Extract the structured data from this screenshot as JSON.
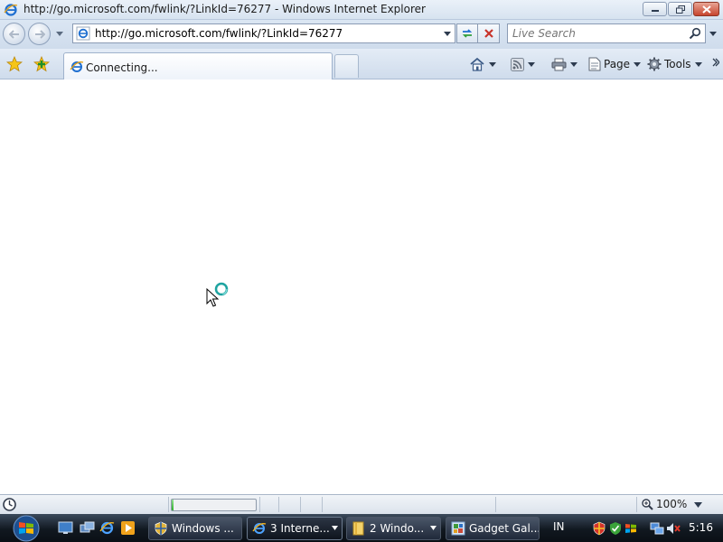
{
  "window": {
    "title": "http://go.microsoft.com/fwlink/?LinkId=76277 - Windows Internet Explorer",
    "buttons": {
      "minimize": "minimize",
      "maximize": "maximize",
      "close": "close"
    }
  },
  "address_bar": {
    "url": "http://go.microsoft.com/fwlink/?LinkId=76277"
  },
  "search": {
    "placeholder": "Live Search"
  },
  "tabs": [
    {
      "label": "Connecting...",
      "active": true
    }
  ],
  "command_bar": {
    "page_label": "Page",
    "tools_label": "Tools"
  },
  "status_bar": {
    "progress_fraction": 0.02,
    "zoom": "100%"
  },
  "taskbar": {
    "tasks": [
      {
        "label": "Windows ...",
        "icon": "shield-icon",
        "active": false
      },
      {
        "label": "3 Interne...",
        "icon": "ie-icon",
        "active": true
      },
      {
        "label": "2 Windo...",
        "icon": "folder-icon",
        "active": false
      },
      {
        "label": "Gadget Gal...",
        "icon": "gadget-icon",
        "active": false
      }
    ],
    "language": "IN",
    "clock": "5:16"
  },
  "colors": {
    "accent": "#2fb12b",
    "taskbar": "#111820",
    "chrome": "#d7e3f0"
  }
}
